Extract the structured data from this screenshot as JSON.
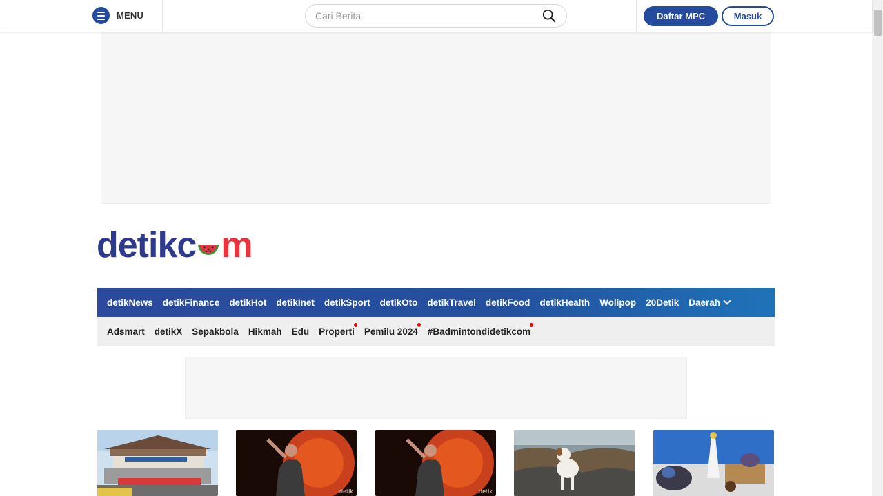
{
  "header": {
    "menu_label": "MENU",
    "search_placeholder": "Cari Berita",
    "register_label": "Daftar MPC",
    "login_label": "Masuk"
  },
  "logo": {
    "part1": "detikc",
    "part2": "m"
  },
  "nav_primary": [
    "detikNews",
    "detikFinance",
    "detikHot",
    "detikInet",
    "detikSport",
    "detikOto",
    "detikTravel",
    "detikFood",
    "detikHealth",
    "Wolipop",
    "20Detik",
    "Daerah"
  ],
  "nav_secondary": [
    {
      "label": "Adsmart",
      "dot": false
    },
    {
      "label": "detikX",
      "dot": false
    },
    {
      "label": "Sepakbola",
      "dot": false
    },
    {
      "label": "Hikmah",
      "dot": false
    },
    {
      "label": "Edu",
      "dot": false
    },
    {
      "label": "Properti",
      "dot": true
    },
    {
      "label": "Pemilu 2024",
      "dot": true
    },
    {
      "label": "#Badmintondidetikcom",
      "dot": true
    }
  ],
  "thumbnails": [
    "toll-gate-photo",
    "concert-singer-photo",
    "concert-singer-photo",
    "dog-on-rocks-photo",
    "tugu-garbage-illustration"
  ],
  "colors": {
    "brand_blue": "#244b9e",
    "logo_blue": "#2e3a8c",
    "logo_red": "#e7343f",
    "dot_red": "#e00000"
  }
}
